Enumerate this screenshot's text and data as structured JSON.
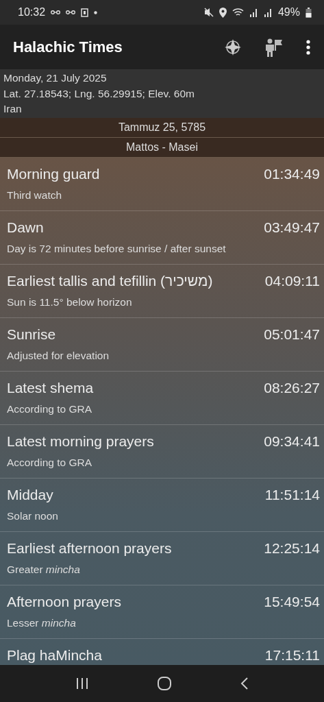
{
  "status_bar": {
    "time": "10:32",
    "battery": "49%"
  },
  "app_bar": {
    "title": "Halachic Times"
  },
  "location": {
    "date": "Monday, 21 July 2025",
    "coordinates": "Lat. 27.18543; Lng. 56.29915; Elev. 60m",
    "place": "Iran"
  },
  "hebrew_date": "Tammuz 25, 5785",
  "parsha": "Mattos - Masei",
  "times": [
    {
      "title": "Morning guard",
      "time": "01:34:49",
      "summary": "Third watch"
    },
    {
      "title": "Dawn",
      "time": "03:49:47",
      "summary": "Day is 72 minutes before sunrise / after sunset"
    },
    {
      "title": "Earliest tallis and tefillin (משיכיר)",
      "time": "04:09:11",
      "summary": "Sun is 11.5° below horizon"
    },
    {
      "title": "Sunrise",
      "time": "05:01:47",
      "summary": "Adjusted for elevation"
    },
    {
      "title": "Latest shema",
      "time": "08:26:27",
      "summary": "According to GRA"
    },
    {
      "title": "Latest morning prayers",
      "time": "09:34:41",
      "summary": "According to GRA"
    },
    {
      "title": "Midday",
      "time": "11:51:14",
      "summary": "Solar noon"
    },
    {
      "title": "Earliest afternoon prayers",
      "time": "12:25:14",
      "summary": "Greater *mincha*"
    },
    {
      "title": "Afternoon prayers",
      "time": "15:49:54",
      "summary": "Lesser *mincha*"
    },
    {
      "title": "Plag haMincha",
      "time": "17:15:11"
    }
  ]
}
